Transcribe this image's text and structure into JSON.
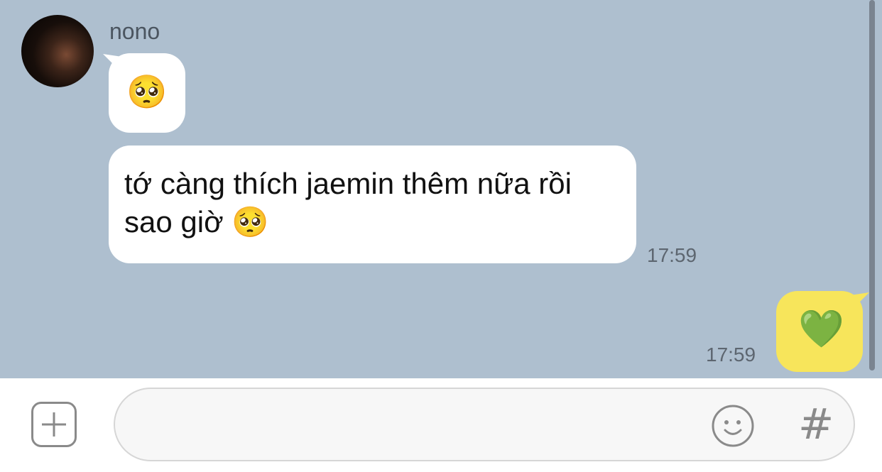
{
  "chat": {
    "sender_name": "nono",
    "messages": [
      {
        "from": "nono",
        "text": "🥺",
        "type": "emoji"
      },
      {
        "from": "nono",
        "text_line1": "tớ càng thích jaemin thêm nữa rồi",
        "text_line2": "sao giờ",
        "emoji": "🥺",
        "time": "17:59"
      },
      {
        "from": "me",
        "text": "💚",
        "time": "17:59"
      }
    ]
  },
  "input": {
    "placeholder": "",
    "plus_icon": "plus-icon",
    "emoji_icon": "smiley-icon",
    "hash_label": "#"
  },
  "colors": {
    "chat_background": "#aebfcf",
    "incoming_bubble": "#ffffff",
    "outgoing_bubble": "#f7e55b"
  }
}
